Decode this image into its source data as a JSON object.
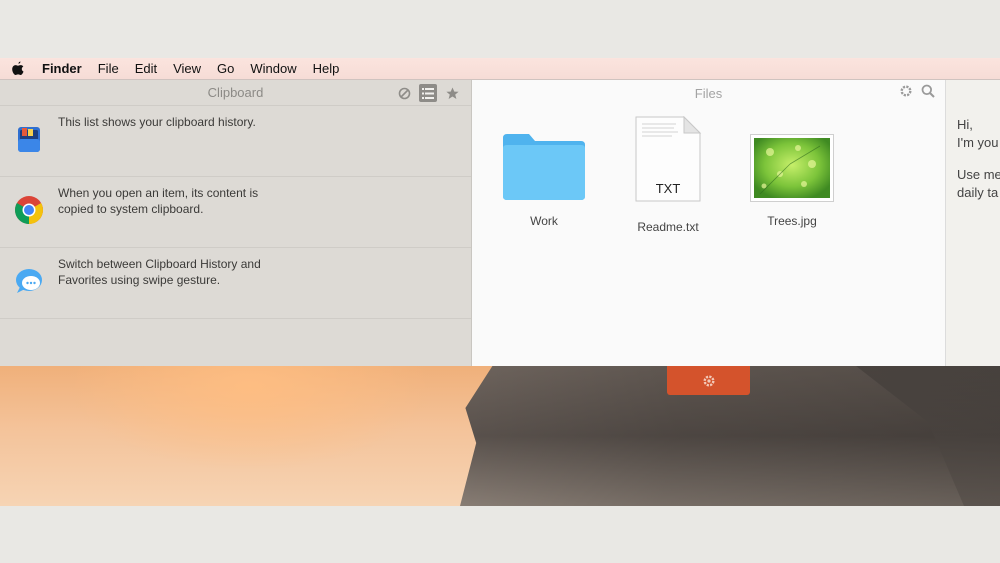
{
  "menubar": {
    "app_name": "Finder",
    "items": [
      "File",
      "Edit",
      "View",
      "Go",
      "Window",
      "Help"
    ]
  },
  "clipboard_panel": {
    "title": "Clipboard",
    "tools": [
      "clear-icon",
      "list-icon",
      "star-icon"
    ],
    "items": [
      {
        "icon": "clipboard-app-icon",
        "text": "This list shows your clipboard history."
      },
      {
        "icon": "chrome-icon",
        "text": "When you open an item, its content is copied to system clipboard."
      },
      {
        "icon": "messages-icon",
        "text": "Switch between Clipboard History and Favorites using swipe gesture."
      }
    ]
  },
  "files_panel": {
    "title": "Files",
    "tools": [
      "gear-icon",
      "search-icon"
    ],
    "files": [
      {
        "name": "Work",
        "type": "folder"
      },
      {
        "name": "Readme.txt",
        "type": "text",
        "badge": "TXT"
      },
      {
        "name": "Trees.jpg",
        "type": "image"
      }
    ]
  },
  "chat_panel": {
    "greeting": "Hi,",
    "line2": "I'm you",
    "line3": "Use me",
    "line4": "daily ta"
  },
  "colors": {
    "gear_tab": "#d4532c",
    "folder": "#5ec0f5"
  }
}
